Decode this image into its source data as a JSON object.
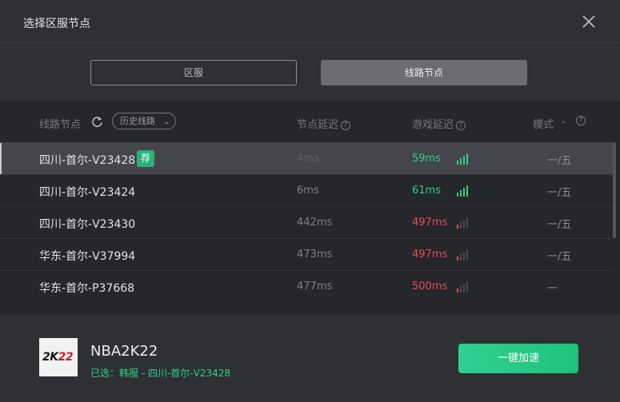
{
  "window": {
    "title": "选择区服节点"
  },
  "tabs": [
    {
      "label": "区服"
    },
    {
      "label": "线路节点"
    }
  ],
  "header": {
    "node": "线路节点",
    "history": "历史线路",
    "node_delay": "节点延迟",
    "game_delay": "游戏延迟",
    "mode": "模式"
  },
  "rows": [
    {
      "name": "四川-首尔-V23428",
      "badge": "荐",
      "node_delay": "4ms",
      "game_delay": "59ms",
      "status": "good",
      "mode": "一/五"
    },
    {
      "name": "四川-首尔-V23424",
      "badge": "",
      "node_delay": "6ms",
      "game_delay": "61ms",
      "status": "good",
      "mode": "一/五"
    },
    {
      "name": "四川-首尔-V23430",
      "badge": "",
      "node_delay": "442ms",
      "game_delay": "497ms",
      "status": "bad",
      "mode": "一/五"
    },
    {
      "name": "华东-首尔-V37994",
      "badge": "",
      "node_delay": "473ms",
      "game_delay": "497ms",
      "status": "bad",
      "mode": "一/五"
    },
    {
      "name": "华东-首尔-P37668",
      "badge": "",
      "node_delay": "477ms",
      "game_delay": "500ms",
      "status": "bad",
      "mode": "一"
    }
  ],
  "footer": {
    "cover_text_a": "2K",
    "cover_text_b": "22",
    "game_name": "NBA2K22",
    "selected": "已选：韩服 - 四川-首尔-V23428",
    "accelerate": "一键加速"
  },
  "colors": {
    "good": "#2fd088",
    "bad": "#e54a55",
    "accent_button": "#22c47e"
  },
  "icons": {
    "close": "close-icon",
    "refresh": "refresh-icon",
    "help": "help-icon",
    "signal": "signal-bars-icon"
  }
}
